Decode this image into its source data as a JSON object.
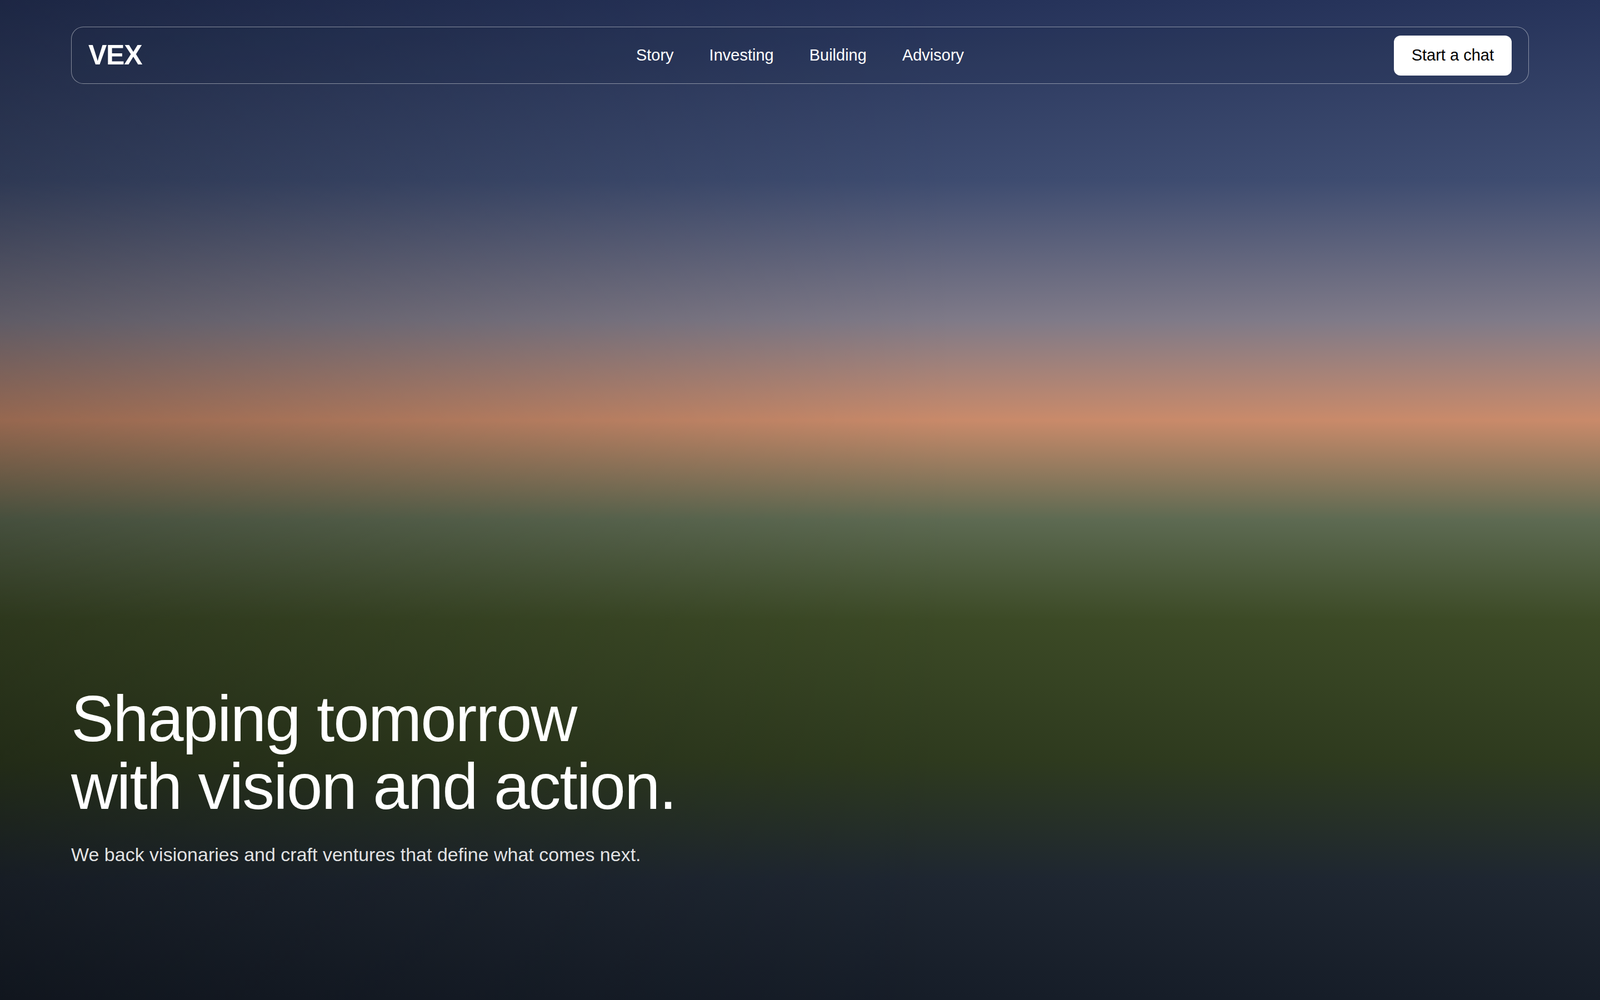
{
  "nav": {
    "logo": "VEX",
    "links": [
      "Story",
      "Investing",
      "Building",
      "Advisory"
    ],
    "cta": "Start a chat"
  },
  "hero": {
    "headline": [
      "Shaping tomorrow",
      "with vision and action."
    ],
    "subtitle": "We back visionaries and craft ventures that define what comes next."
  }
}
